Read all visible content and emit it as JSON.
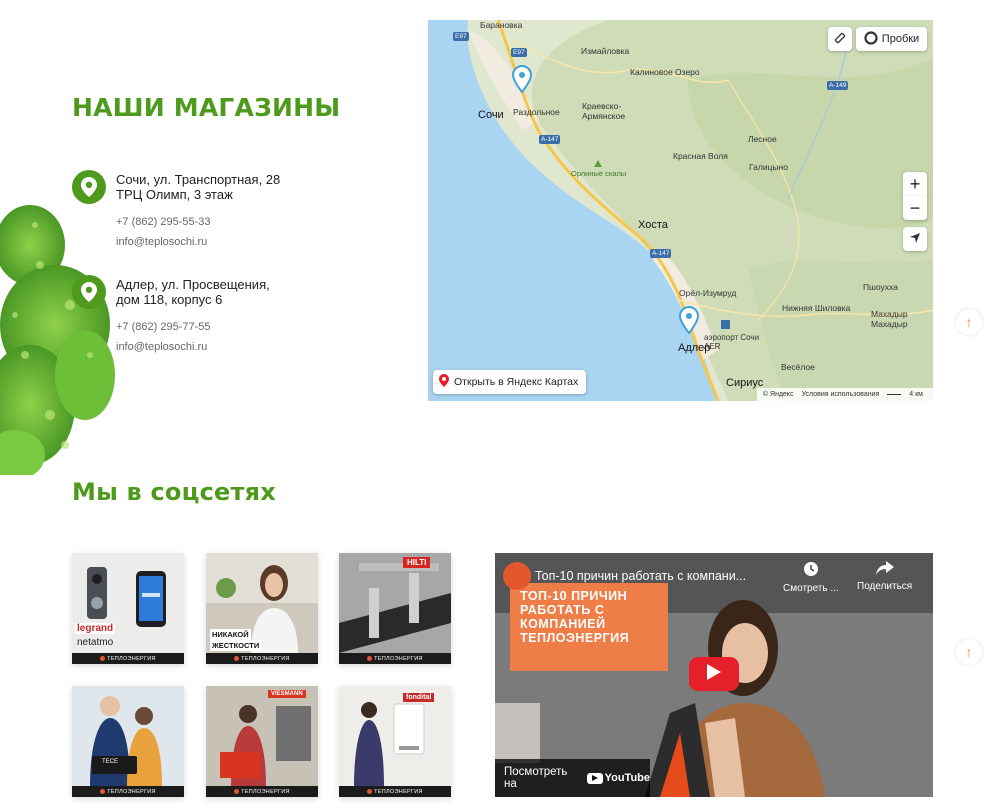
{
  "stores": {
    "title": "НАШИ МАГАЗИНЫ",
    "items": [
      {
        "address": "Сочи, ул. Транспортная, 28\nТРЦ Олимп, 3 этаж",
        "phone": "+7 (862) 295-55-33",
        "email": "info@teplosochi.ru"
      },
      {
        "address": "Адлер, ул. Просвещения,\nдом 118, корпус 6",
        "phone": "+7 (862) 295-77-55",
        "email": "info@teplosochi.ru"
      }
    ]
  },
  "map": {
    "traffic_label": "Пробки",
    "open_label": "Открыть в Яндекс Картах",
    "copyright": "© Яндекс",
    "terms": "Условия использования",
    "scale": "4 км",
    "zoom_in": "+",
    "zoom_out": "−",
    "places": {
      "baranovka": "Барановка",
      "izmailovka": "Измайловка",
      "kalinovoe": "Калиновое Озеро",
      "sochi": "Сочи",
      "razdolnoe": "Раздольное",
      "krasnodar_arm": "Краевско-\nАрмянское",
      "lesnoe": "Лесное",
      "orlinye": "Орлиные скалы",
      "krasnaya_volya": "Красная Воля",
      "galitsyno": "Галицыно",
      "khosta": "Хоста",
      "orel_izumrud": "Орёл-Изумруд",
      "nizhnyaya_shilovka": "Нижняя Шиловка",
      "pshoukha": "Пшоухха",
      "makhadyr": "Махадыр\nМахадыр",
      "airport": "аэропорт Сочи\nAER",
      "adler": "Адлер",
      "veseloe": "Весёлое",
      "sirius": "Сириус"
    },
    "roads": {
      "e97a": "E97",
      "e97b": "E97",
      "a147a": "A-147",
      "a147b": "A-147",
      "a149": "A-149"
    }
  },
  "social": {
    "title": "Мы в соцсетях",
    "brand_footer": "ТЕПЛОЭНЕРГИЯ",
    "thumbs": [
      {
        "caption1": "legrand",
        "caption2": "netatmo"
      },
      {
        "caption1": "НИКАКОЙ",
        "caption2": "ЖЕСТКОСТИ"
      },
      {
        "caption1": "HILTI",
        "caption2": ""
      },
      {
        "caption1": "TECE",
        "caption2": ""
      },
      {
        "caption1": "VIESMANN",
        "caption2": ""
      },
      {
        "caption1": "fondital",
        "caption2": ""
      }
    ]
  },
  "video": {
    "title": "Топ-10 причин работать с компани...",
    "watch_later": "Смотреть ...",
    "share": "Поделиться",
    "banner": "ТОП-10 ПРИЧИН\nРАБОТАТЬ С\nКОМПАНИЕЙ\nТЕПЛОЭНЕРГИЯ",
    "watch_on": "Посмотреть на",
    "youtube": "YouTube"
  },
  "scroll_up_icon": "↑",
  "colors": {
    "brand_green": "#4e9a1c",
    "accent_orange": "#e8912f",
    "youtube_red": "#e5202a"
  }
}
